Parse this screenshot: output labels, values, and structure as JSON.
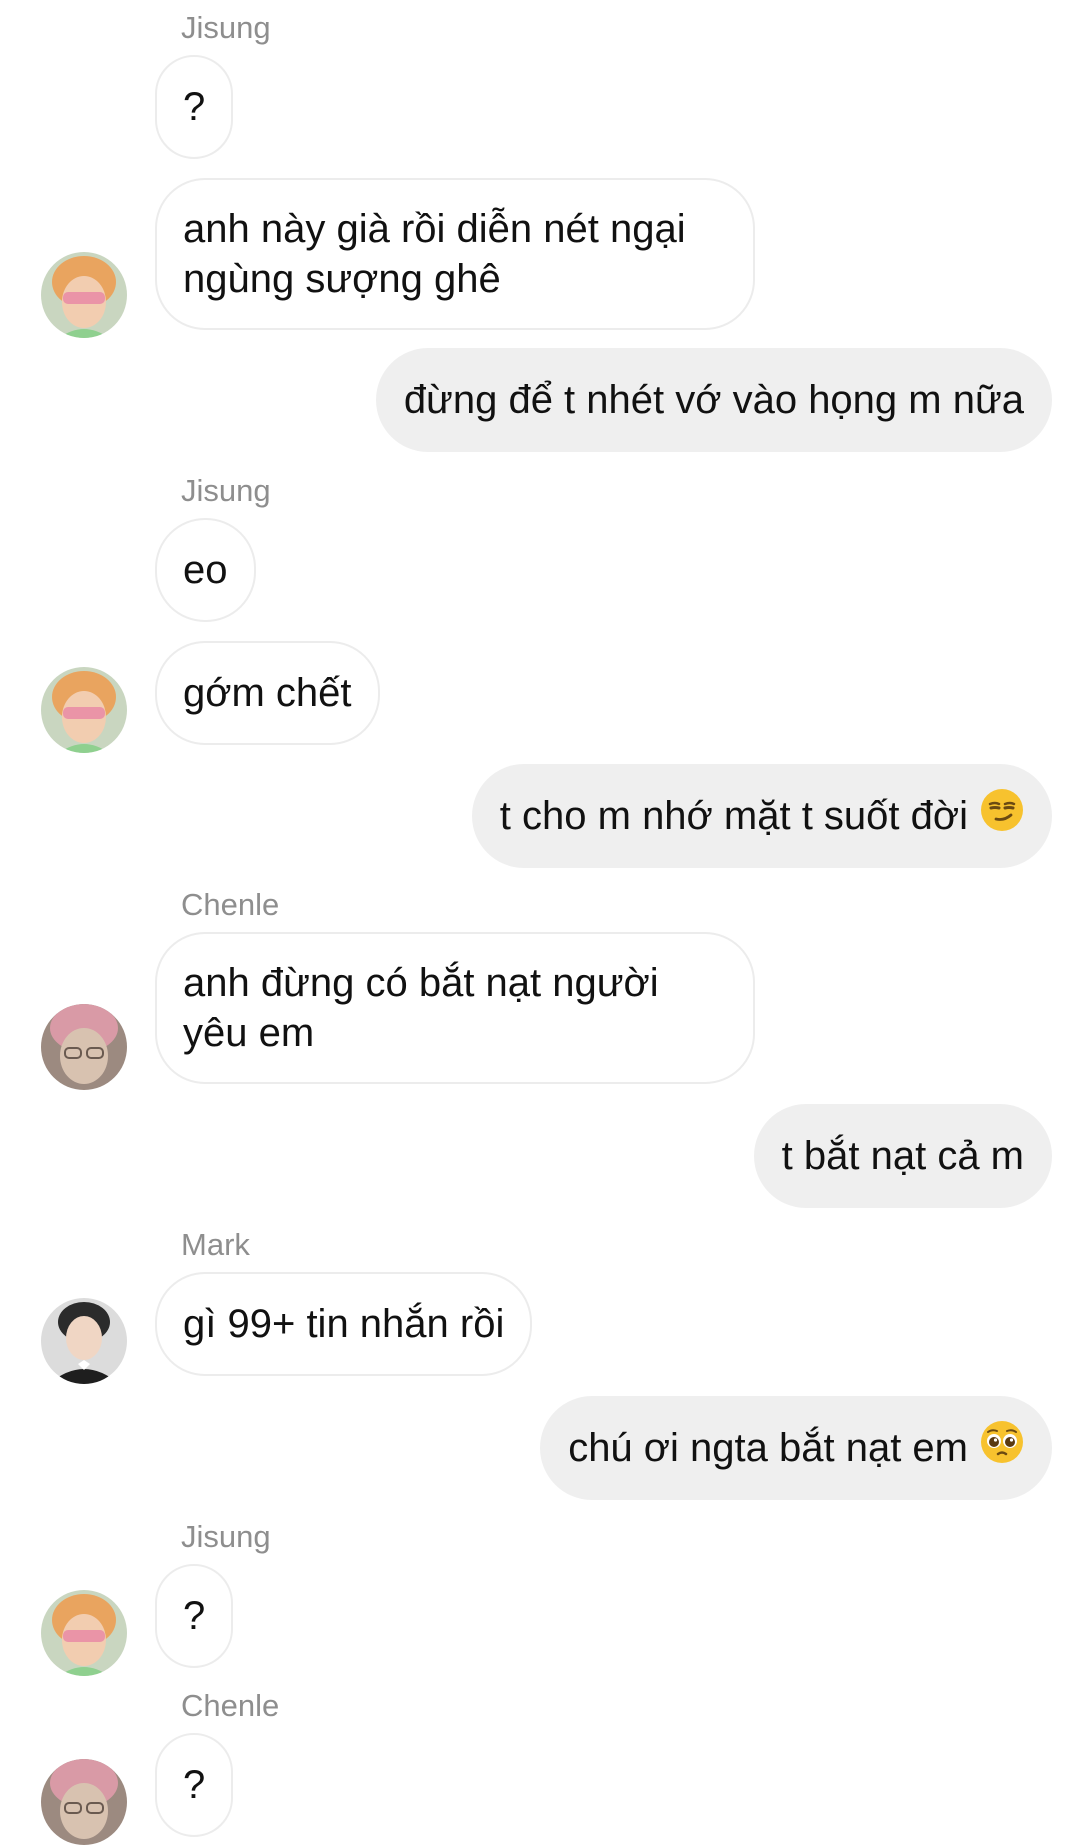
{
  "messages": [
    {
      "sender": "Jisung",
      "text": "?"
    },
    {
      "text_lines": [
        "anh này già rồi diễn nét ngại",
        "ngùng sượng ghê"
      ]
    },
    {
      "text": "đừng để t nhét vớ vào họng m nữa"
    },
    {
      "sender": "Jisung",
      "text": "eo"
    },
    {
      "text": "gớm chết"
    },
    {
      "text": "t cho m nhớ mặt t suốt đời",
      "emoji": "smirking-face-emoji"
    },
    {
      "sender": "Chenle",
      "text_lines": [
        "anh đừng có bắt nạt người",
        "yêu em"
      ]
    },
    {
      "text": "t bắt nạt cả m"
    },
    {
      "sender": "Mark",
      "text": "gì 99+ tin nhắn rồi"
    },
    {
      "text": "chú ơi ngta bắt nạt em",
      "emoji": "pleading-face-emoji"
    },
    {
      "sender": "Jisung",
      "text": "?"
    },
    {
      "sender": "Chenle",
      "text": "?"
    }
  ],
  "colors": {
    "outgoing_bubble": "#efefef",
    "incoming_border": "#ececec",
    "sender_name": "#8e8e8e",
    "text": "#111111"
  }
}
